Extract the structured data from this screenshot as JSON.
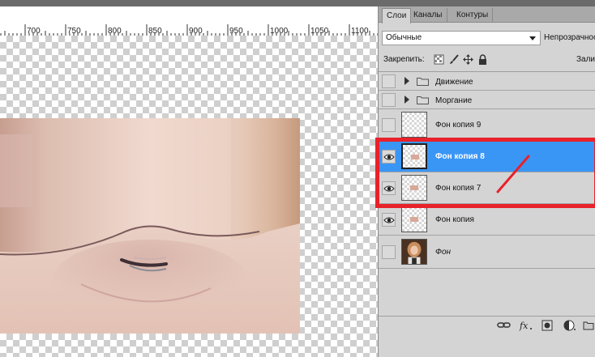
{
  "ruler": {
    "labels": [
      "700",
      "750",
      "800",
      "850",
      "900",
      "950",
      "1000",
      "1050",
      "1100"
    ]
  },
  "panel": {
    "tabs": [
      {
        "label": "Слои",
        "active": true
      },
      {
        "label": "Каналы",
        "active": false
      },
      {
        "label": "Контуры",
        "active": false
      }
    ],
    "blend_mode": "Обычные",
    "opacity_label": "Непрозрачность:",
    "lock_label": "Закрепить:",
    "fill_label": "Заливка:",
    "layers": [
      {
        "name": "Движение",
        "type": "group",
        "visible": false,
        "selected": false
      },
      {
        "name": "Моргание",
        "type": "group",
        "visible": false,
        "selected": false
      },
      {
        "name": "Фон копия 9",
        "type": "layer",
        "visible": false,
        "selected": false
      },
      {
        "name": "Фон копия 8",
        "type": "layer",
        "visible": true,
        "selected": true
      },
      {
        "name": "Фон копия 7",
        "type": "layer",
        "visible": true,
        "selected": false
      },
      {
        "name": "Фон копия",
        "type": "layer",
        "visible": true,
        "selected": false
      },
      {
        "name": "Фон",
        "type": "background",
        "visible": false,
        "selected": false
      }
    ],
    "bottom_icons": [
      "link-icon",
      "fx-icon",
      "mask-icon",
      "adjustment-icon",
      "group-icon"
    ]
  },
  "colors": {
    "selection": "#3a96f5",
    "annotation": "#e8212a",
    "panel_bg": "#d4d4d4"
  }
}
